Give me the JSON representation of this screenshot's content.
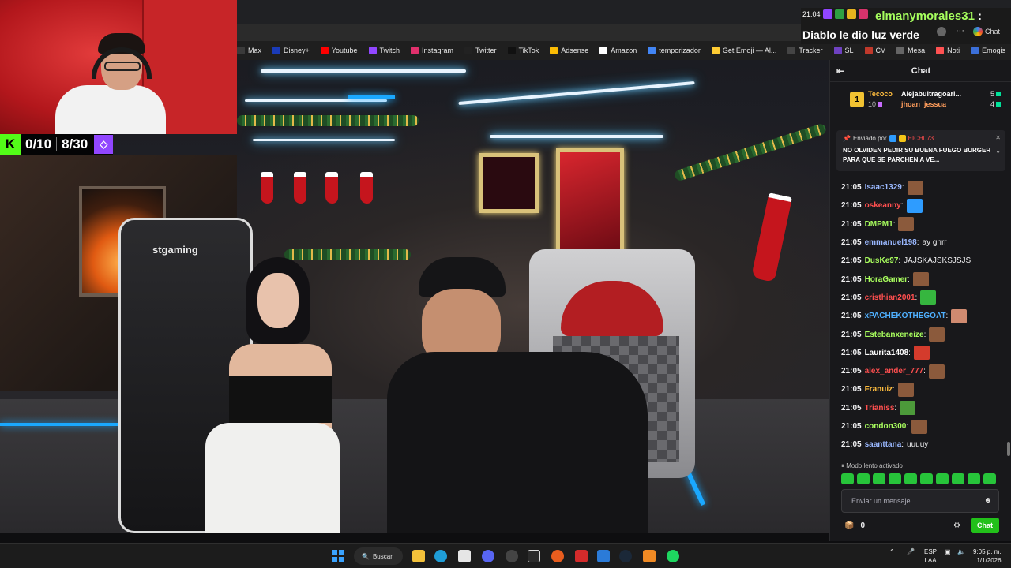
{
  "bookmarks": [
    {
      "label": "Max",
      "color": "#3a3a3a"
    },
    {
      "label": "Disney+",
      "color": "#1a3bb8"
    },
    {
      "label": "Youtube",
      "color": "#ff0000"
    },
    {
      "label": "Twitch",
      "color": "#9146ff"
    },
    {
      "label": "Instagram",
      "color": "#e1306c"
    },
    {
      "label": "Twitter",
      "color": "#222222"
    },
    {
      "label": "TikTok",
      "color": "#111111"
    },
    {
      "label": "Adsense",
      "color": "#fbbc04"
    },
    {
      "label": "Amazon",
      "color": "#ffffff"
    },
    {
      "label": "temporizador",
      "color": "#4285f4"
    },
    {
      "label": "Get Emoji — Al...",
      "color": "#ffcc33"
    },
    {
      "label": "Tracker",
      "color": "#444444"
    },
    {
      "label": "SL",
      "color": "#6f42c1"
    },
    {
      "label": "CV",
      "color": "#c0392b"
    },
    {
      "label": "Mesa",
      "color": "#666666"
    },
    {
      "label": "Noti",
      "color": "#ff5252"
    },
    {
      "label": "Emogis",
      "color": "#3b6fd8"
    }
  ],
  "bookmarks_more_icon": "chevron-right-icon",
  "goal": {
    "kick_letter": "K",
    "kick_count": "0/10",
    "twitch_count": "8/30"
  },
  "highlight": {
    "time": "21:04",
    "username": "elmanymorales31",
    "colon": ":",
    "message": "Diablo le dio luz verde",
    "chat_button": "Chat",
    "more": "···"
  },
  "chat": {
    "header": "Chat",
    "leaderboard": {
      "rank": "1",
      "top_name": "Tecoco",
      "top_count": "10",
      "row1_name": "Alejabuitragoari...",
      "row1_count": "5",
      "row2_name": "jhoan_jessua",
      "row2_count": "4"
    },
    "pinned": {
      "by_label": "Enviado por",
      "by_user": "EICH073",
      "message": "NO OLVIDEN PEDIR SU BUENA FUEGO BURGER PARA QUE SE PARCHEN A VE..."
    },
    "messages": [
      {
        "time": "21:05",
        "user": "Isaac1329",
        "color": "#9ab8ff",
        "text": "",
        "emote": "#8b5a3c"
      },
      {
        "time": "21:05",
        "user": "oskeanny",
        "color": "#ff4f4f",
        "text": "",
        "emote": "#2e9cff"
      },
      {
        "time": "21:05",
        "user": "DMPM1",
        "color": "#a9ff5e",
        "text": "",
        "emote": "#8b5a3c"
      },
      {
        "time": "21:05",
        "user": "emmanuel198",
        "color": "#9ab8ff",
        "text": "ay gnrr",
        "emote": ""
      },
      {
        "time": "21:05",
        "user": "DusKe97",
        "color": "#a9ff5e",
        "text": "JAJSKAJSKSJSJS",
        "emote": ""
      },
      {
        "time": "21:05",
        "user": "HoraGamer",
        "color": "#a9ff5e",
        "text": "",
        "emote": "#8b5a3c"
      },
      {
        "time": "21:05",
        "user": "cristhian2001",
        "color": "#ff4f4f",
        "text": "",
        "emote": "#36b63f"
      },
      {
        "time": "21:05",
        "user": "xPACHEKOTHEGOAT",
        "color": "#4fb0ff",
        "text": "",
        "emote": "#d08a70"
      },
      {
        "time": "21:05",
        "user": "Estebanxeneize",
        "color": "#a9ff5e",
        "text": "",
        "emote": "#8b5a3c"
      },
      {
        "time": "21:05",
        "user": "Laurita1408",
        "color": "#ffffff",
        "text": "",
        "emote": "#d43b2c"
      },
      {
        "time": "21:05",
        "user": "alex_ander_777",
        "color": "#ff4f4f",
        "text": "",
        "emote": "#8b5a3c"
      },
      {
        "time": "21:05",
        "user": "Franuiz",
        "color": "#ffbd3e",
        "text": "",
        "emote": "#8b5a3c"
      },
      {
        "time": "21:05",
        "user": "Trianiss",
        "color": "#ff4f4f",
        "text": "",
        "emote": "#4c9a3a"
      },
      {
        "time": "21:05",
        "user": "condon300",
        "color": "#a9ff5e",
        "text": "",
        "emote": "#8b5a3c"
      },
      {
        "time": "21:05",
        "user": "saanttana",
        "color": "#9ab8ff",
        "text": "uuuuy",
        "emote": ""
      }
    ],
    "slow_mode": "Modo lento activado",
    "input_placeholder": "Enviar un mensaje",
    "points": "0",
    "send_button": "Chat"
  },
  "taskbar": {
    "search": "Buscar",
    "lang_top": "ESP",
    "lang_bottom": "LAA",
    "time": "9:05 p. m.",
    "date": "1/1/2026"
  },
  "scene": {
    "chair_brand": "stgaming"
  }
}
